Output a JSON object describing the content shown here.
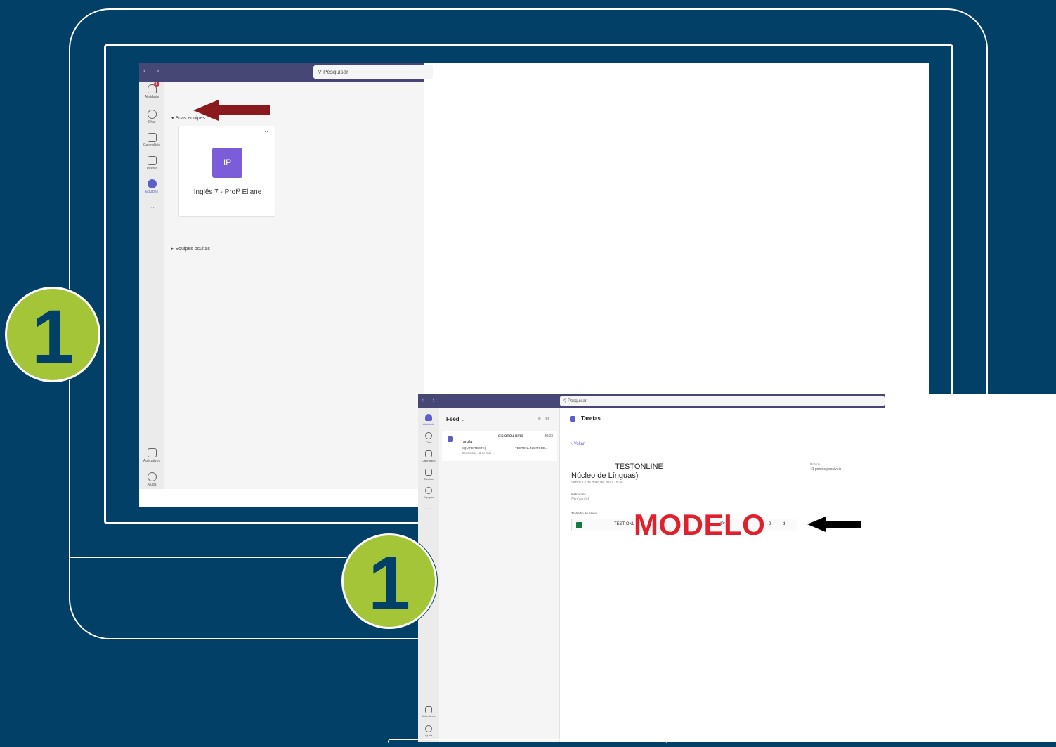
{
  "screen1": {
    "search_placeholder": "Pesquisar",
    "rail": {
      "atividade": "Atividade",
      "atividade_badge": "1",
      "chat": "Chat",
      "calendario": "Calendário",
      "tarefas": "Tarefas",
      "equipes": "Equipes",
      "more": "···",
      "aplicativos": "Aplicativos",
      "ajuda": "Ajuda"
    },
    "section_teams": "Suas equipes",
    "team_card": {
      "avatar_initials": "IP",
      "name": "Inglês 7 - Profª Eliane",
      "more": "···"
    },
    "section_hidden": "Equipes ocultas"
  },
  "screen2": {
    "search_placeholder": "Pesquisar",
    "rail": {
      "atividade": "Atividade",
      "chat": "Chat",
      "calendario": "Calendário",
      "tarefas": "Tarefas",
      "equipes": "Equipes",
      "more": "···",
      "aplicativos": "Aplicativos",
      "ajuda": "Ajuda"
    },
    "feed": {
      "title": "Feed",
      "item": {
        "line1": "dicionou uma",
        "time": "20:03",
        "line2": "tarefa",
        "team": "EQUIPE TESTE |",
        "assignment": "TESTONLINE MODE...",
        "due": "Conclusão 13 de mai"
      }
    },
    "tab_title": "Tarefas",
    "back_label": "Voltar",
    "assignment": {
      "title_line1": "TESTONLINE",
      "title_line2": "Núcleo de Línguas)",
      "due": "Vence 13 de maio de 2021 15:30",
      "points_label": "Pontos",
      "points_value": "41 pontos possíveis",
      "instructions_label": "Instruções",
      "instructions_value": "Nenhum(a)",
      "work_label": "Trabalho de aluno",
      "file_name": "TEST ONL",
      "file_name_tail": "(Pr",
      "file_name_tail2": "2",
      "file_name_tail3": "d",
      "file_more": "···"
    },
    "overlay_label": "MODELO"
  },
  "steps": {
    "step1": "1",
    "step2": "1"
  },
  "colors": {
    "background": "#034067",
    "teams_bar": "#464775",
    "accent_purple": "#5b5fc7",
    "badge_green": "#a3c537",
    "modelo_red": "#e0212d",
    "arrow_red": "#8b1a1e"
  }
}
